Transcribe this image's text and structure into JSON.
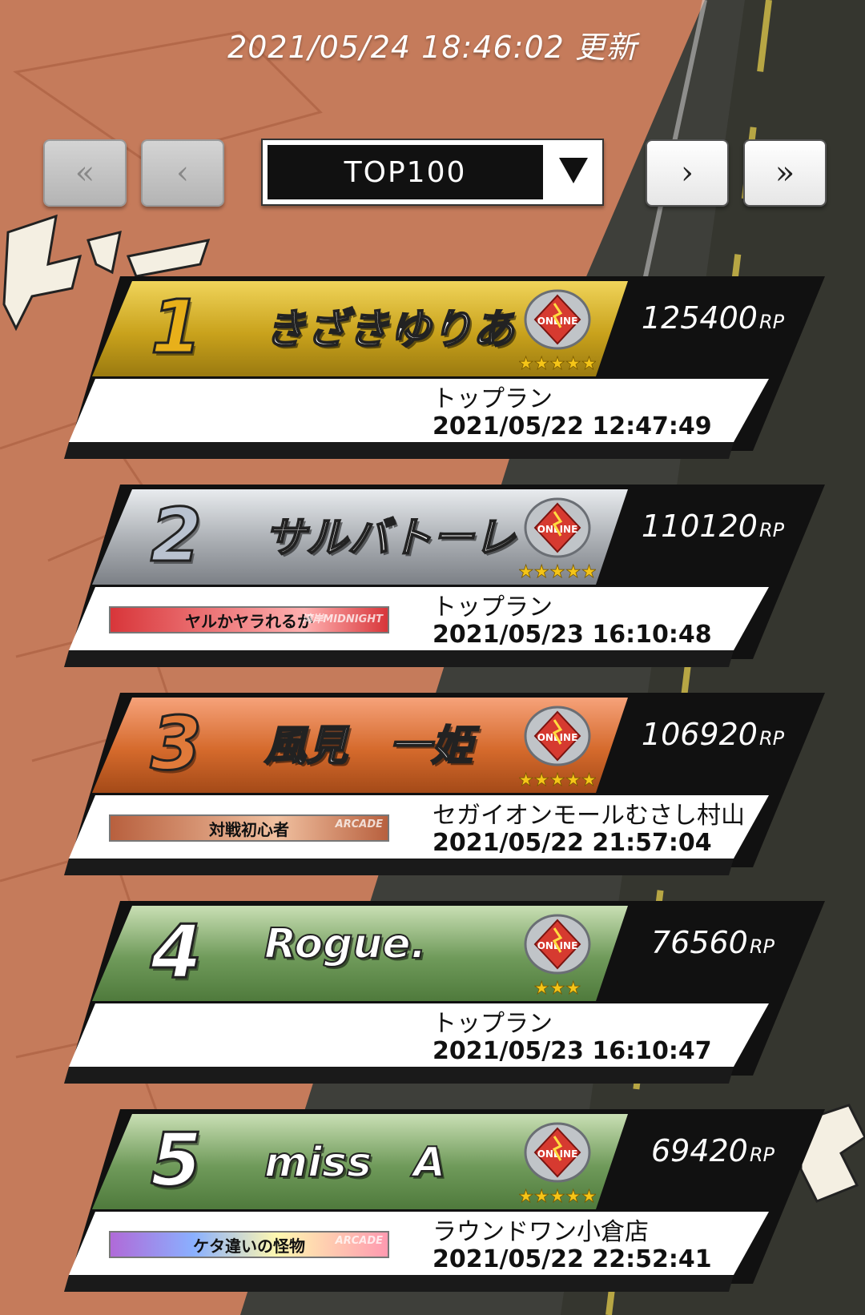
{
  "header": {
    "timestamp": "2021/05/24 18:46:02 更新"
  },
  "pagination": {
    "first_label": "«",
    "prev_label": "‹",
    "next_label": "›",
    "last_label": "»",
    "range_selected": "TOP100"
  },
  "colors": {
    "gold": "#c9a21c",
    "silver": "#a9adb2",
    "bronze": "#d56a2c",
    "green": "#6f9a5a"
  },
  "entries": [
    {
      "rank": "1",
      "name": "きざきゆりあ",
      "points": "125400",
      "unit": "RP",
      "location": "トップラン",
      "datetime": "2021/05/22 12:47:49",
      "stars": "★★★★★",
      "emblem": "ONLINE",
      "title": "",
      "title_tag": ""
    },
    {
      "rank": "2",
      "name": "サルバトーレ",
      "points": "110120",
      "unit": "RP",
      "location": "トップラン",
      "datetime": "2021/05/23 16:10:48",
      "stars": "★★★★★",
      "emblem": "ONLINE",
      "title": "ヤルかヤラれるか",
      "title_tag": "湾岸MIDNIGHT"
    },
    {
      "rank": "3",
      "name": "風見　一姫",
      "points": "106920",
      "unit": "RP",
      "location": "セガイオンモールむさし村山",
      "datetime": "2021/05/22 21:57:04",
      "stars": "★★★★★",
      "emblem": "ONLINE",
      "title": "対戦初心者",
      "title_tag": "ARCADE"
    },
    {
      "rank": "4",
      "name": "Rogue.",
      "points": "76560",
      "unit": "RP",
      "location": "トップラン",
      "datetime": "2021/05/23 16:10:47",
      "stars": "★★★",
      "emblem": "ONLINE",
      "title": "",
      "title_tag": ""
    },
    {
      "rank": "5",
      "name": "miss　A",
      "points": "69420",
      "unit": "RP",
      "location": "ラウンドワン小倉店",
      "datetime": "2021/05/22 22:52:41",
      "stars": "★★★★★",
      "emblem": "ONLINE",
      "title": "ケタ違いの怪物",
      "title_tag": "ARCADE"
    }
  ]
}
